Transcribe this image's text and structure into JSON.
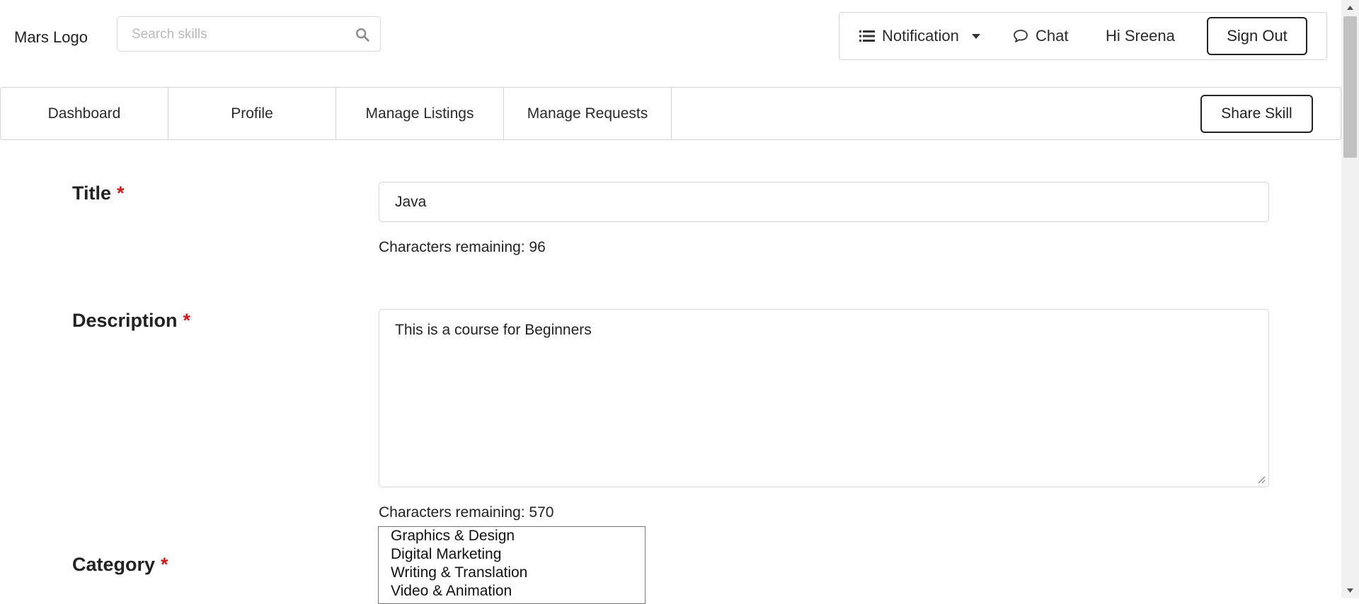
{
  "header": {
    "logo": "Mars Logo",
    "search_placeholder": "Search skills",
    "notification_label": "Notification",
    "chat_label": "Chat",
    "greeting": "Hi Sreena",
    "signout_label": "Sign Out"
  },
  "nav": {
    "tabs": [
      "Dashboard",
      "Profile",
      "Manage Listings",
      "Manage Requests"
    ],
    "share_label": "Share Skill"
  },
  "form": {
    "title": {
      "label": "Title",
      "required_mark": "*",
      "value": "Java",
      "counter": "Characters remaining: 96"
    },
    "description": {
      "label": "Description",
      "required_mark": "*",
      "value": "This is a course for Beginners",
      "counter": "Characters remaining: 570"
    },
    "category": {
      "label": "Category",
      "required_mark": "*",
      "options": [
        "Graphics & Design",
        "Digital Marketing",
        "Writing & Translation",
        "Video & Animation"
      ]
    }
  },
  "colors": {
    "required": "#d01919",
    "border": "#d4d4d5",
    "text": "#222222"
  },
  "icons": {
    "search": "search-icon",
    "notification": "list-icon",
    "chat": "chat-bubble-icon"
  }
}
